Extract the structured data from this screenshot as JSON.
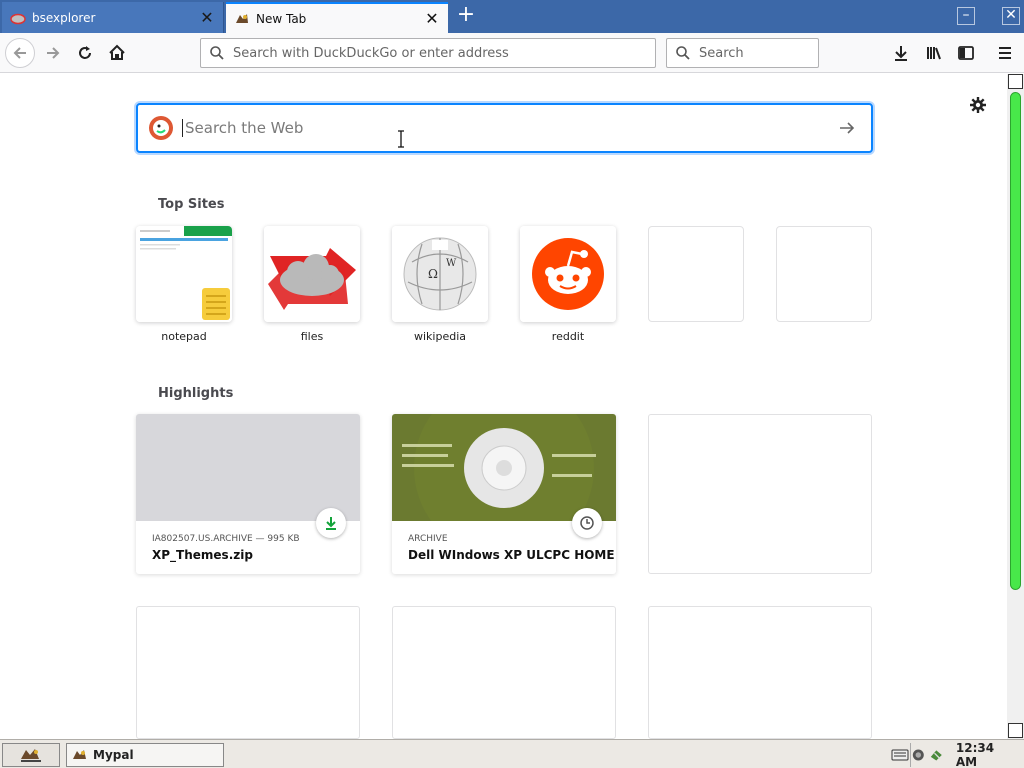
{
  "tabs": [
    {
      "title": "bsexplorer",
      "active": false
    },
    {
      "title": "New Tab",
      "active": true
    }
  ],
  "navbar": {
    "url_placeholder": "Search with DuckDuckGo or enter address",
    "search_placeholder": "Search"
  },
  "newtab": {
    "web_search_placeholder": "Search the Web",
    "top_sites_title": "Top Sites",
    "top_sites": [
      {
        "label": "notepad"
      },
      {
        "label": "files"
      },
      {
        "label": "wikipedia"
      },
      {
        "label": "reddit"
      }
    ],
    "highlights_title": "Highlights",
    "highlights": [
      {
        "source": "IA802507.US.ARCHIVE — 995 KB",
        "title": "XP_Themes.zip",
        "badge": "download-icon"
      },
      {
        "source": "ARCHIVE",
        "title": "Dell WIndows XP ULCPC HOME ...",
        "badge": "clock-icon"
      }
    ]
  },
  "taskbar": {
    "task_label": "Mypal",
    "clock": "12:34 AM"
  },
  "colors": {
    "accent": "#0a84ff",
    "tabstrip": "#3c68a8",
    "scroll_thumb": "#48e84a"
  }
}
